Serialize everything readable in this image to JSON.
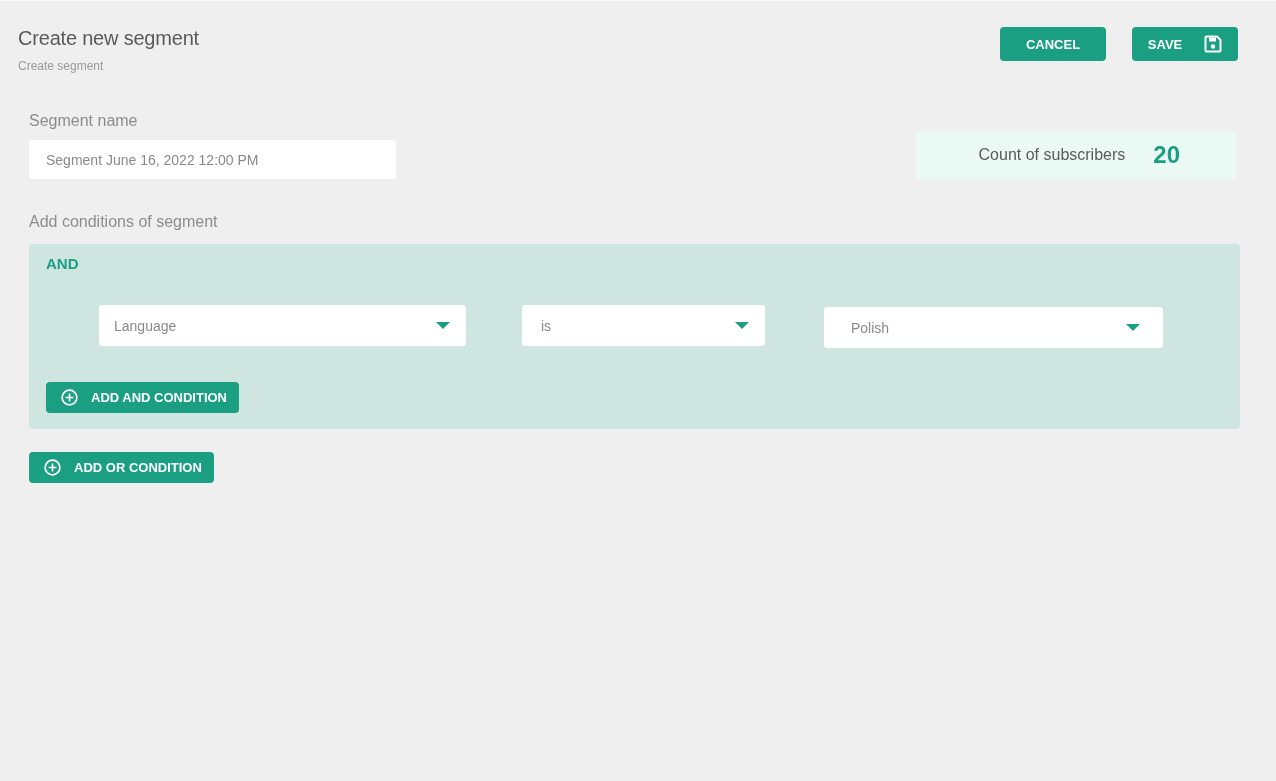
{
  "header": {
    "title": "Create new segment",
    "subtitle": "Create segment"
  },
  "actions": [
    {
      "label": "CANCEL",
      "kind": "plain"
    },
    {
      "label": "SAVE",
      "kind": "save"
    }
  ],
  "segment_name": {
    "label": "Segment name",
    "value": "Segment June 16, 2022 12:00 PM"
  },
  "subscriber_count": {
    "label": "Count of subscribers",
    "value": "20"
  },
  "conditions": {
    "label": "Add conditions of segment",
    "groups": [
      {
        "operator": "AND",
        "rules": [
          {
            "field": "Language",
            "comparison": "is",
            "value": "Polish"
          }
        ],
        "add_button": "ADD AND CONDITION"
      }
    ],
    "add_button": "ADD OR CONDITION"
  }
}
